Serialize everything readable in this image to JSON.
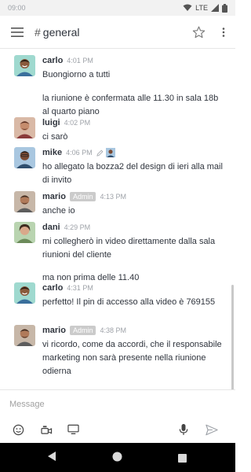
{
  "status": {
    "time": "09:00",
    "network": "LTE"
  },
  "header": {
    "hash": "#",
    "channel": "general"
  },
  "messages": [
    {
      "user": "carlo",
      "time": "4:01 PM",
      "lines": [
        "Buongiorno a tutti",
        "la riunione è confermata alle 11.30 in sala 18b al quarto piano"
      ]
    },
    {
      "user": "luigi",
      "time": "4:02 PM",
      "lines": [
        "ci sarò"
      ]
    },
    {
      "user": "mike",
      "time": "4:06 PM",
      "edited": true,
      "lines": [
        "ho allegato la bozza2 del design di ieri alla mail di invito"
      ]
    },
    {
      "user": "mario",
      "badge": "Admin",
      "time": "4:13 PM",
      "lines": [
        "anche io"
      ]
    },
    {
      "user": "dani",
      "time": "4:29 PM",
      "lines": [
        "mi collegherò in video direttamente dalla sala riunioni del cliente",
        "ma non prima delle 11.40"
      ]
    },
    {
      "user": "carlo",
      "time": "4:31 PM",
      "lines": [
        "perfetto! Il pin di accesso alla video è 769155"
      ]
    },
    {
      "user": "mario",
      "badge": "Admin",
      "time": "4:38 PM",
      "lines": [
        "vi ricordo, come da accordi, che il responsabile marketing non sarà presente nella riunione odierna"
      ]
    }
  ],
  "composer": {
    "placeholder": "Message"
  },
  "icons": {
    "menu": "menu-icon",
    "star": "star-icon",
    "more": "more-vertical-icon",
    "emoji": "emoji-icon",
    "video": "video-camera-icon",
    "screen": "screen-share-icon",
    "mic": "microphone-icon",
    "send": "send-icon"
  },
  "colors": {
    "accent": "#1d74f5",
    "badge": "#cbcbcb",
    "text": "#2f343d",
    "muted": "#9ea2a8"
  }
}
